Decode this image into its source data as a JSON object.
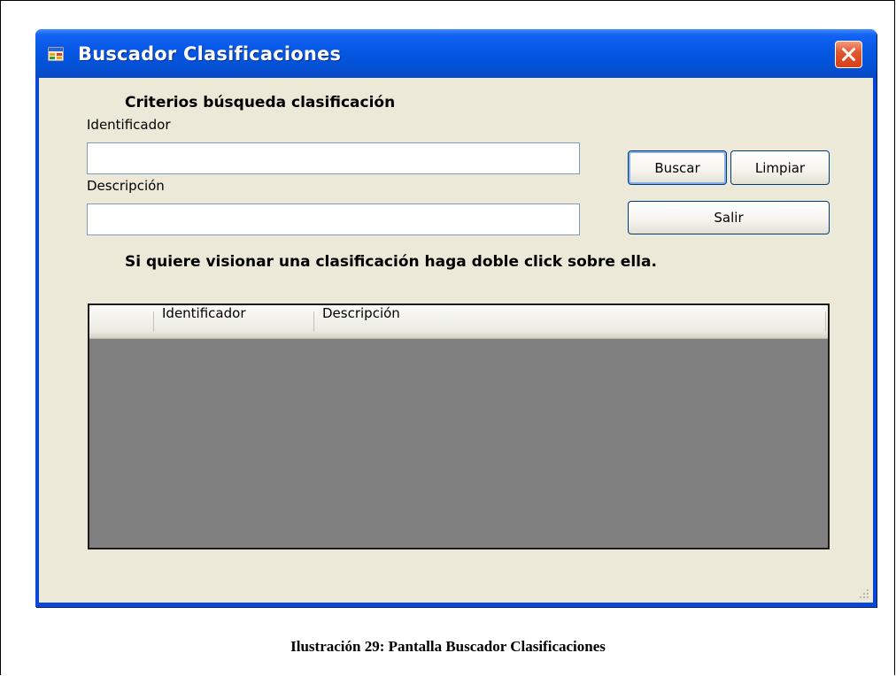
{
  "window": {
    "title": "Buscador Clasificaciones"
  },
  "form": {
    "criteria_heading": "Criterios búsqueda clasificación",
    "identificador_label": "Identificador",
    "identificador_value": "",
    "descripcion_label": "Descripción",
    "descripcion_value": "",
    "buttons": {
      "buscar": "Buscar",
      "limpiar": "Limpiar",
      "salir": "Salir"
    },
    "hint": "Si quiere visionar una clasificación haga doble click sobre ella."
  },
  "grid": {
    "columns": [
      "Identificador",
      "Descripción"
    ],
    "rows": []
  },
  "caption": "Ilustración 29: Pantalla Buscador Clasificaciones",
  "colors": {
    "titlebar": "#0556e4",
    "client": "#ece9d8",
    "grid_empty": "#808080",
    "close_button": "#d63f16"
  },
  "icons": {
    "app": "form-window-icon",
    "close": "close-icon",
    "resize": "resize-grip-icon"
  }
}
